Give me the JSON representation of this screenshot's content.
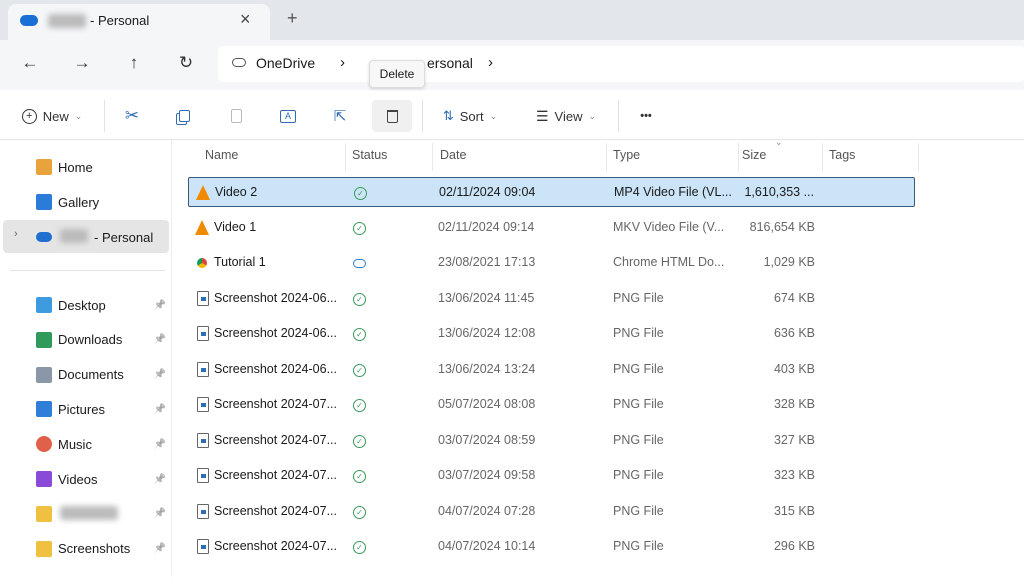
{
  "window": {
    "tab_title": "- Personal",
    "close": "×",
    "new_tab": "+"
  },
  "nav": {
    "back": "←",
    "forward": "→",
    "up": "↑",
    "refresh": "↻"
  },
  "address": {
    "root": "OneDrive",
    "sep": "›",
    "current": "ersonal",
    "sep2": "›"
  },
  "tooltip": "Delete",
  "toolbar": {
    "new": "New",
    "sort": "Sort",
    "view": "View",
    "more": "•••",
    "caret": "⌄"
  },
  "sidebar": {
    "top": [
      {
        "label": "Home",
        "color": "#e8a33c"
      },
      {
        "label": "Gallery",
        "color": "#2b7bd8"
      },
      {
        "label": "- Personal",
        "color": "#1e6fd0"
      }
    ],
    "pinned": [
      {
        "label": "Desktop",
        "color": "#3f9be0"
      },
      {
        "label": "Downloads",
        "color": "#2f9a5a"
      },
      {
        "label": "Documents",
        "color": "#8a97a8"
      },
      {
        "label": "Pictures",
        "color": "#2f7ed8"
      },
      {
        "label": "Music",
        "color": "#e0604a"
      },
      {
        "label": "Videos",
        "color": "#8a4ad8"
      },
      {
        "label": "",
        "color": "#f0c040"
      },
      {
        "label": "Screenshots",
        "color": "#f0c040"
      }
    ]
  },
  "columns": [
    "Name",
    "Status",
    "Date",
    "Type",
    "Size",
    "Tags"
  ],
  "files": [
    {
      "name": "Video 2",
      "status": "synced",
      "date": "02/11/2024 09:04",
      "type": "MP4 Video File (VL...",
      "size": "1,610,353 ...",
      "icon": "vlc",
      "selected": true
    },
    {
      "name": "Video 1",
      "status": "synced",
      "date": "02/11/2024 09:14",
      "type": "MKV Video File (V...",
      "size": "816,654 KB",
      "icon": "vlc"
    },
    {
      "name": "Tutorial 1",
      "status": "cloud",
      "date": "23/08/2021 17:13",
      "type": "Chrome HTML Do...",
      "size": "1,029 KB",
      "icon": "chrome"
    },
    {
      "name": "Screenshot 2024-06...",
      "status": "synced",
      "date": "13/06/2024 11:45",
      "type": "PNG File",
      "size": "674 KB",
      "icon": "png"
    },
    {
      "name": "Screenshot 2024-06...",
      "status": "synced",
      "date": "13/06/2024 12:08",
      "type": "PNG File",
      "size": "636 KB",
      "icon": "png"
    },
    {
      "name": "Screenshot 2024-06...",
      "status": "synced",
      "date": "13/06/2024 13:24",
      "type": "PNG File",
      "size": "403 KB",
      "icon": "png"
    },
    {
      "name": "Screenshot 2024-07...",
      "status": "synced",
      "date": "05/07/2024 08:08",
      "type": "PNG File",
      "size": "328 KB",
      "icon": "png"
    },
    {
      "name": "Screenshot 2024-07...",
      "status": "synced",
      "date": "03/07/2024 08:59",
      "type": "PNG File",
      "size": "327 KB",
      "icon": "png"
    },
    {
      "name": "Screenshot 2024-07...",
      "status": "synced",
      "date": "03/07/2024 09:58",
      "type": "PNG File",
      "size": "323 KB",
      "icon": "png"
    },
    {
      "name": "Screenshot 2024-07...",
      "status": "synced",
      "date": "04/07/2024 07:28",
      "type": "PNG File",
      "size": "315 KB",
      "icon": "png"
    },
    {
      "name": "Screenshot 2024-07...",
      "status": "synced",
      "date": "04/07/2024 10:14",
      "type": "PNG File",
      "size": "296 KB",
      "icon": "png"
    }
  ]
}
